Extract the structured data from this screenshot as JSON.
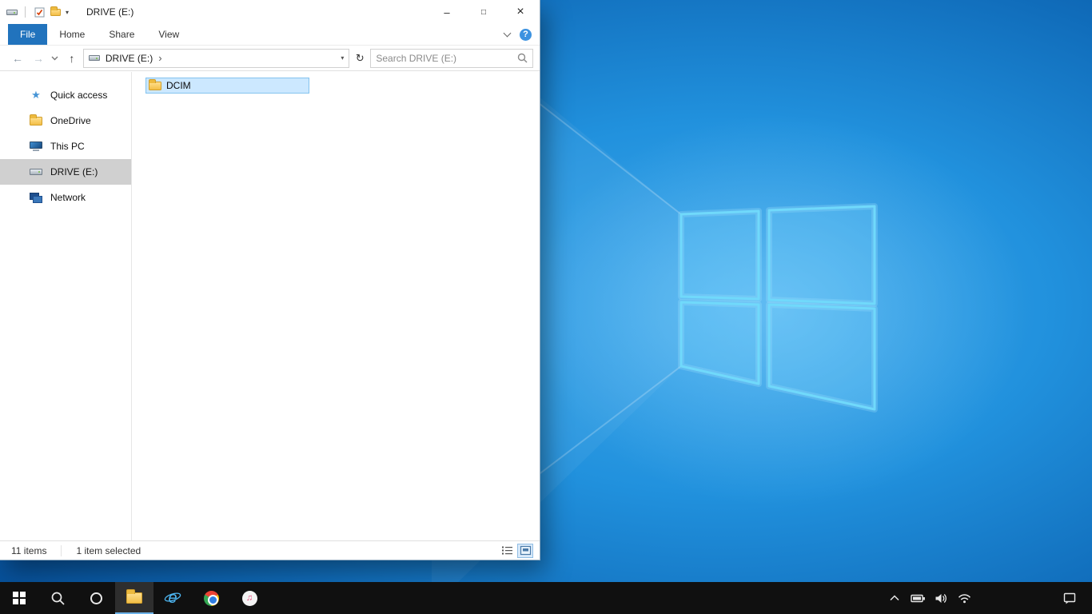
{
  "explorer": {
    "titlebar": {
      "title": "DRIVE (E:)",
      "qat_dropdown_glyph": "▾",
      "minimize_glyph": "–",
      "maximize_glyph": "□",
      "close_glyph": "×"
    },
    "ribbon": {
      "tabs": [
        "File",
        "Home",
        "Share",
        "View"
      ],
      "active_tab": "File",
      "help_glyph": "?"
    },
    "navigation": {
      "back_glyph": "←",
      "forward_glyph": "→",
      "up_glyph": "↑",
      "crumb": "DRIVE (E:)",
      "crumb_separator": "›",
      "address_dropdown_glyph": "▾",
      "refresh_glyph": "↻",
      "search_placeholder": "Search DRIVE (E:)"
    },
    "sidebar": {
      "items": [
        {
          "label": "Quick access",
          "icon": "quick-access-star-icon"
        },
        {
          "label": "OneDrive",
          "icon": "onedrive-folder-icon"
        },
        {
          "label": "This PC",
          "icon": "this-pc-icon"
        },
        {
          "label": "DRIVE (E:)",
          "icon": "drive-icon",
          "selected": true
        },
        {
          "label": "Network",
          "icon": "network-icon"
        }
      ]
    },
    "files": [
      {
        "name": "DCIM",
        "icon": "folder-icon",
        "selected": true
      }
    ],
    "statusbar": {
      "item_count": "11 items",
      "selection": "1 item selected"
    }
  },
  "taskbar": {
    "buttons": [
      {
        "name": "start",
        "icon": "windows-start-icon"
      },
      {
        "name": "search",
        "icon": "search-icon"
      },
      {
        "name": "cortana",
        "icon": "cortana-icon"
      },
      {
        "name": "file-explorer",
        "icon": "file-explorer-icon",
        "active": true
      },
      {
        "name": "internet-explorer",
        "icon": "internet-explorer-icon"
      },
      {
        "name": "chrome",
        "icon": "chrome-icon"
      },
      {
        "name": "itunes",
        "icon": "itunes-icon"
      }
    ],
    "ie_glyph": "e",
    "itunes_glyph": "♫",
    "tray": [
      {
        "name": "hidden-icons",
        "icon": "chevron-up-icon"
      },
      {
        "name": "battery",
        "icon": "battery-icon"
      },
      {
        "name": "volume",
        "icon": "speaker-icon"
      },
      {
        "name": "network",
        "icon": "wifi-icon"
      }
    ],
    "action_center_icon": "action-center-icon"
  },
  "colors": {
    "accent": "#0078d7",
    "selection_fill": "#cce8ff",
    "selection_border": "#84c3ee",
    "sidebar_selected": "#d0d0d0",
    "file_tab_blue": "#2173bd",
    "taskbar_bg": "#101010",
    "wallpaper_light": "#3fa9ec",
    "wallpaper_dark": "#07519b",
    "logo_stroke": "#70d9fb"
  }
}
